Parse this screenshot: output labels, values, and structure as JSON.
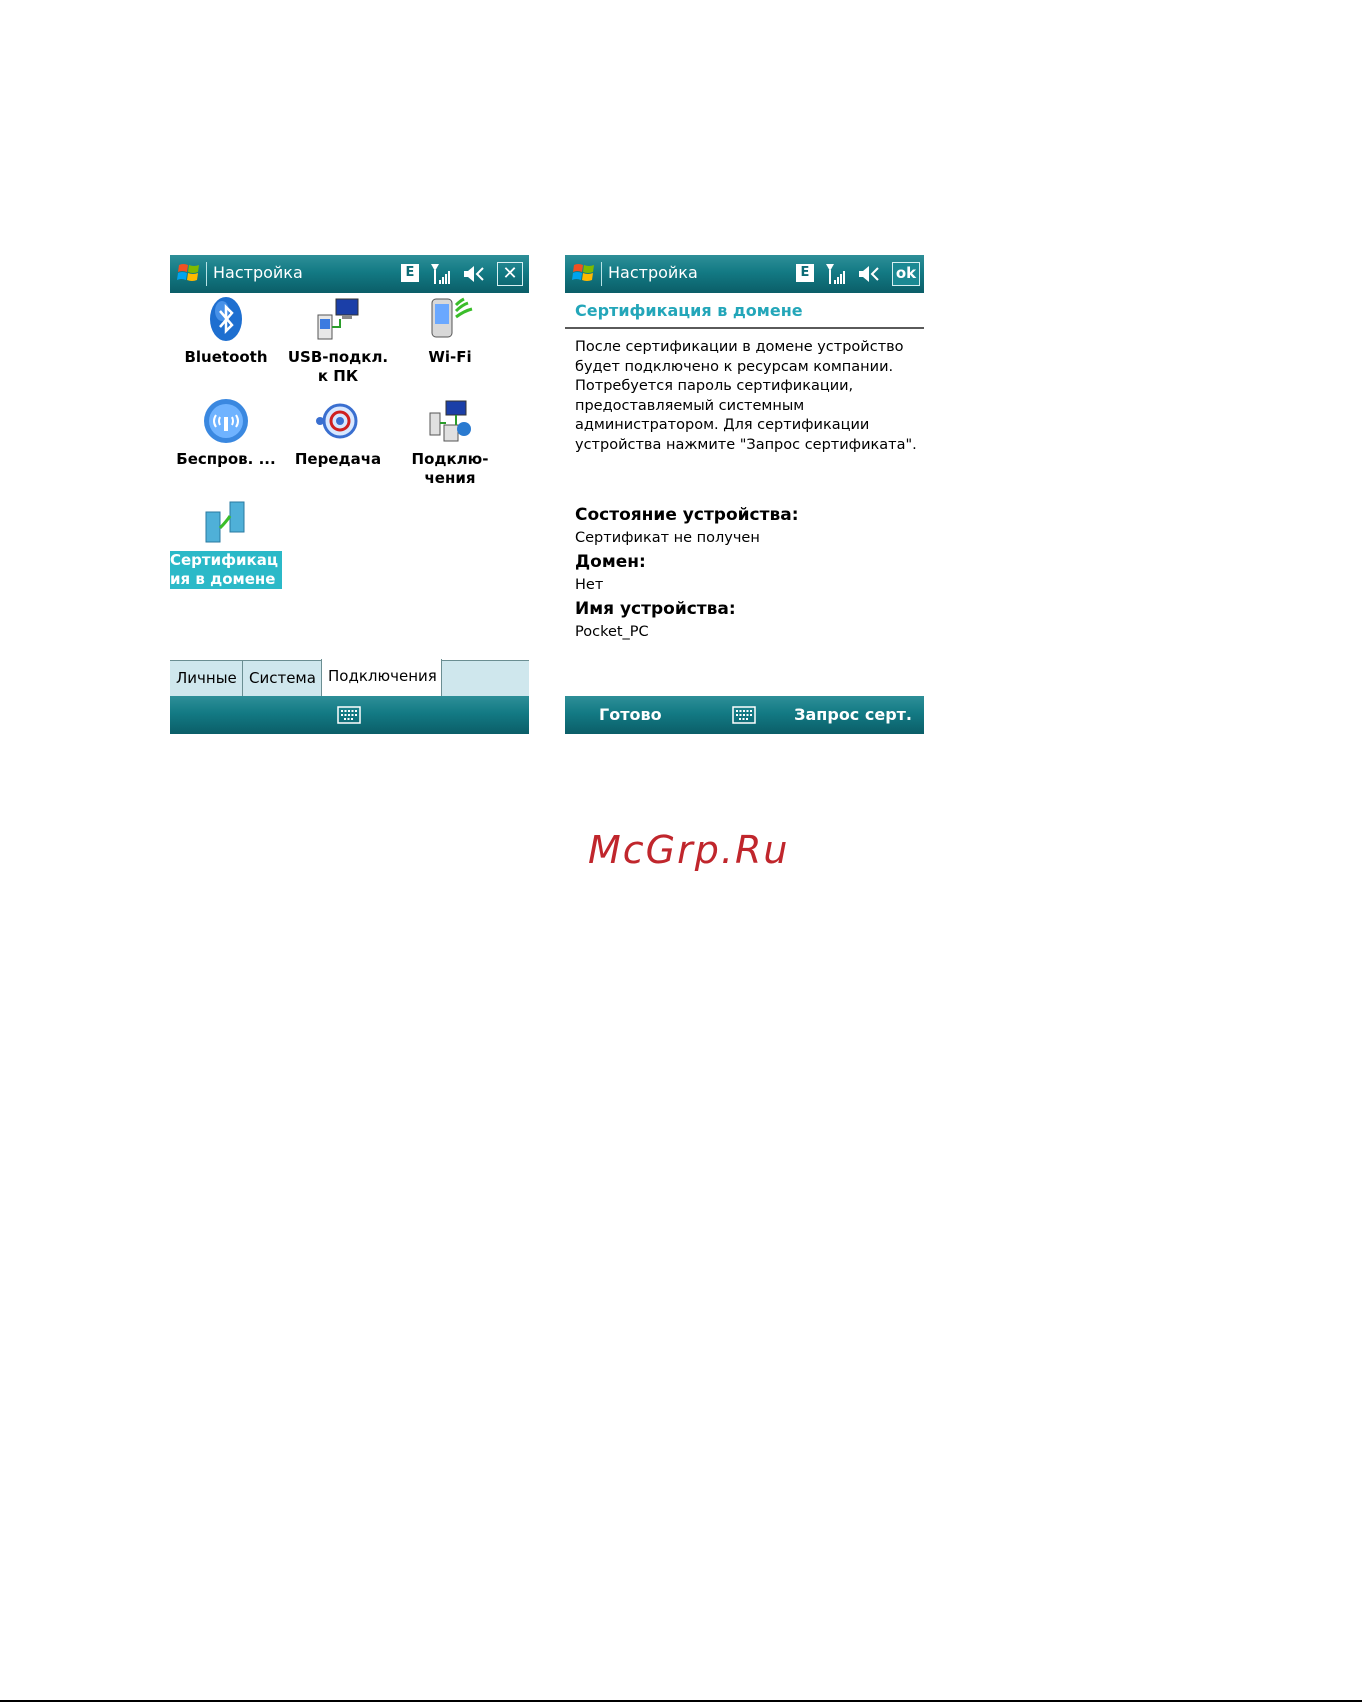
{
  "left_screen": {
    "title": "Настройка",
    "indicator_e": "E",
    "close_glyph": "✕",
    "apps": [
      {
        "name": "bluetooth",
        "label": "Bluetooth"
      },
      {
        "name": "usb",
        "label": "USB-подкл.\nк ПК"
      },
      {
        "name": "wifi",
        "label": "Wi-Fi"
      },
      {
        "name": "wireless",
        "label": "Беспров. ..."
      },
      {
        "name": "beam",
        "label": "Передача"
      },
      {
        "name": "connections",
        "label": "Подклю-\nчения"
      },
      {
        "name": "domain-enroll",
        "label": "Сертификац\nия в домене"
      }
    ],
    "tabs": [
      "Личные",
      "Система",
      "Подключения"
    ],
    "active_tab": "Подключения"
  },
  "right_screen": {
    "title": "Настройка",
    "indicator_e": "E",
    "ok_label": "ok",
    "heading": "Сертификация в домене",
    "description": "После сертификации в домене устройство будет подключено к ресурсам компании. Потребуется пароль сертификации, предоставляемый системным администратором. Для сертификации устройства нажмите \"Запрос сертификата\".",
    "status_label": "Состояние устройства:",
    "status_value": "Сертификат не получен",
    "domain_label": "Домен:",
    "domain_value": "Нет",
    "device_name_label": "Имя устройства:",
    "device_name_value": "Pocket_PC",
    "soft_left": "Готово",
    "soft_right": "Запрос серт."
  },
  "watermark": "McGrp.Ru",
  "colors": {
    "titlebar": "#137a84",
    "heading": "#23a6b9",
    "selection": "#2bb9c8",
    "watermark": "#c0262c"
  }
}
